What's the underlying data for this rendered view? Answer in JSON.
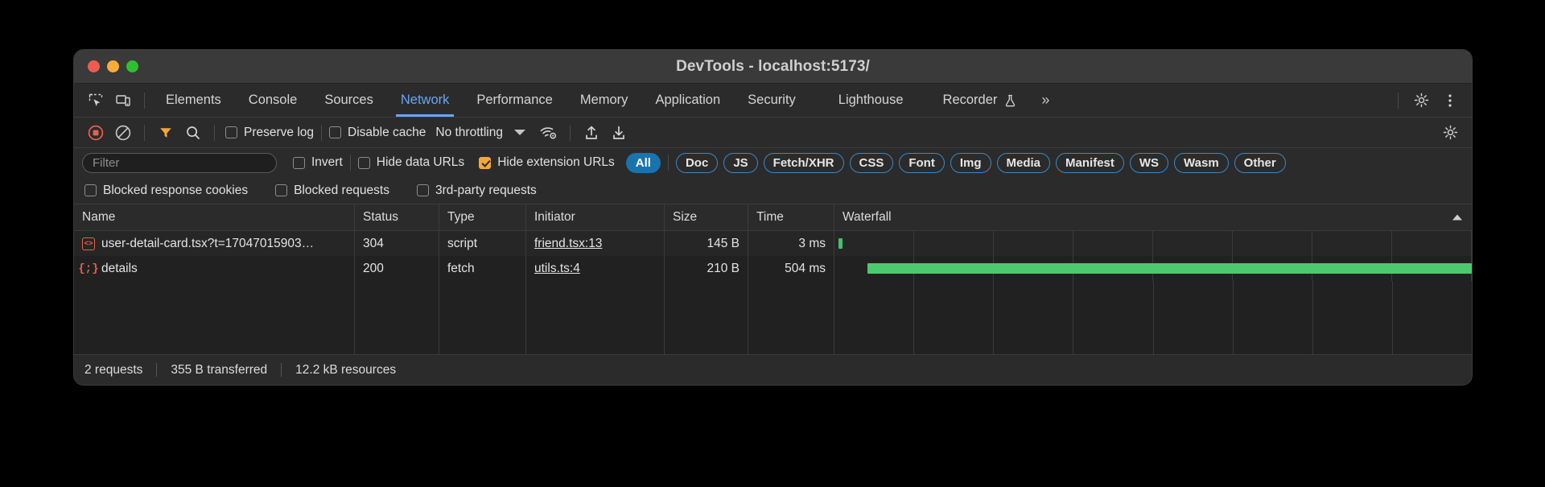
{
  "window": {
    "title": "DevTools - localhost:5173/",
    "traffic_lights": [
      "close-red",
      "minimize-yellow",
      "maximize-green"
    ]
  },
  "tabbar": {
    "left_icons": [
      "inspect-element-icon",
      "device-toolbar-icon"
    ],
    "tabs": [
      {
        "label": "Elements",
        "active": false
      },
      {
        "label": "Console",
        "active": false
      },
      {
        "label": "Sources",
        "active": false
      },
      {
        "label": "Network",
        "active": true
      },
      {
        "label": "Performance",
        "active": false
      },
      {
        "label": "Memory",
        "active": false
      },
      {
        "label": "Application",
        "active": false
      },
      {
        "label": "Security",
        "active": false
      },
      {
        "label": "Lighthouse",
        "active": false
      },
      {
        "label": "Recorder",
        "active": false,
        "icon": "flask-icon"
      }
    ],
    "overflow_label": "»",
    "right_icons": [
      "gear-icon",
      "kebab-menu-icon"
    ],
    "active_color": "#67a7f5"
  },
  "network_toolbar": {
    "record_icon": "record-stop-icon",
    "clear_icon": "clear-icon",
    "filter_icon": "filter-funnel-icon",
    "search_icon": "search-icon",
    "preserve_log": {
      "label": "Preserve log",
      "checked": false
    },
    "disable_cache": {
      "label": "Disable cache",
      "checked": false
    },
    "throttling": {
      "value": "No throttling",
      "caret": "chevron-down-icon"
    },
    "wifi_icon": "network-conditions-icon",
    "import_icon": "import-har-icon",
    "export_icon": "export-har-icon",
    "settings_icon": "gear-icon",
    "record_color": "#e8614d",
    "filter_color": "#f2a73b"
  },
  "filter_row": {
    "input": {
      "value": "",
      "placeholder": "Filter"
    },
    "invert": {
      "label": "Invert",
      "checked": false
    },
    "hide_data_urls": {
      "label": "Hide data URLs",
      "checked": false
    },
    "hide_extension_urls": {
      "label": "Hide extension URLs",
      "checked": true
    },
    "pills": [
      {
        "label": "All",
        "active": true
      },
      {
        "label": "Doc",
        "active": false
      },
      {
        "label": "JS",
        "active": false
      },
      {
        "label": "Fetch/XHR",
        "active": false
      },
      {
        "label": "CSS",
        "active": false
      },
      {
        "label": "Font",
        "active": false
      },
      {
        "label": "Img",
        "active": false
      },
      {
        "label": "Media",
        "active": false
      },
      {
        "label": "Manifest",
        "active": false
      },
      {
        "label": "WS",
        "active": false
      },
      {
        "label": "Wasm",
        "active": false
      },
      {
        "label": "Other",
        "active": false
      }
    ],
    "pill_accent": "#3a88c9",
    "pill_active_bg": "#1a73ad"
  },
  "checkbox_row": {
    "blocked_response_cookies": {
      "label": "Blocked response cookies",
      "checked": false
    },
    "blocked_requests": {
      "label": "Blocked requests",
      "checked": false
    },
    "third_party_requests": {
      "label": "3rd-party requests",
      "checked": false
    }
  },
  "requests_table": {
    "columns": [
      "Name",
      "Status",
      "Type",
      "Initiator",
      "Size",
      "Time",
      "Waterfall"
    ],
    "sort_indicator": "ascending-arrow",
    "rows": [
      {
        "icon": "js-script-icon",
        "icon_glyph": "<>",
        "name": "user-detail-card.tsx?t=17047015903…",
        "status": "304",
        "type": "script",
        "initiator": "friend.tsx:13",
        "size": "145 B",
        "time": "3 ms",
        "waterfall_start_pct": 0.6,
        "waterfall_width_pct": 0.7,
        "waterfall_color": "#3ec46d"
      },
      {
        "icon": "json-fetch-icon",
        "icon_glyph": "{;}",
        "name": "details",
        "status": "200",
        "type": "fetch",
        "initiator": "utils.ts:4",
        "size": "210 B",
        "time": "504 ms",
        "waterfall_start_pct": 5.2,
        "waterfall_width_pct": 94.8,
        "waterfall_color": "#4cc96f"
      }
    ]
  },
  "footer": {
    "requests": "2 requests",
    "transferred": "355 B transferred",
    "resources": "12.2 kB resources"
  }
}
